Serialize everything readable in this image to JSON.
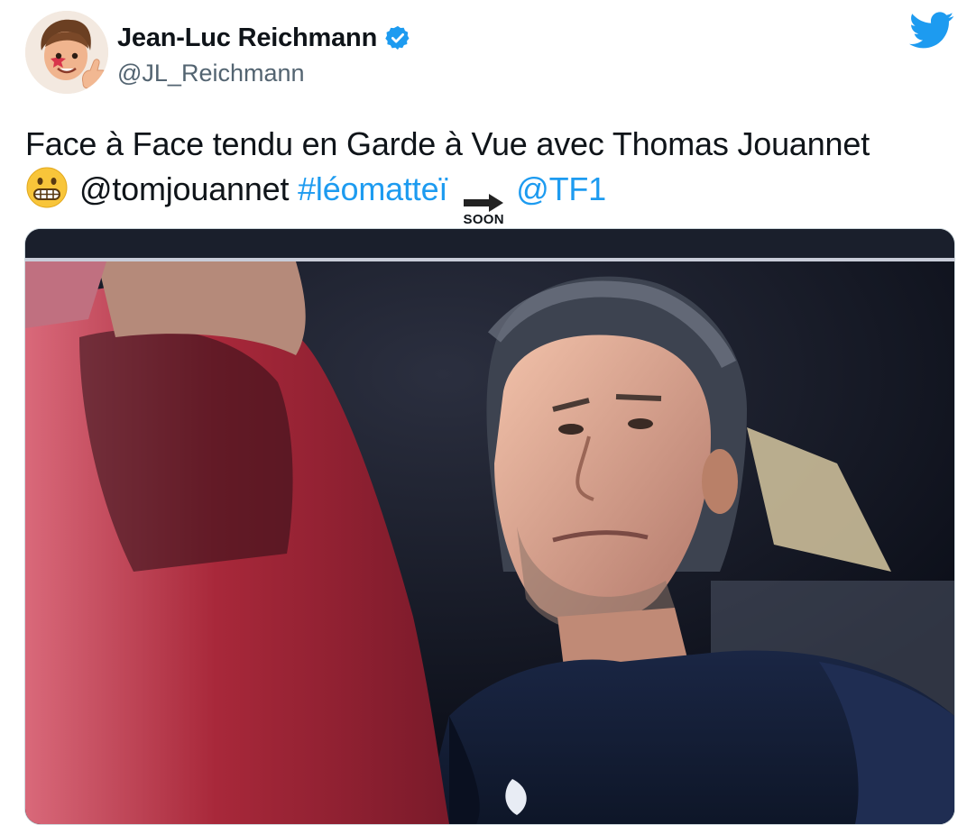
{
  "tweet": {
    "author": {
      "display_name": "Jean-Luc Reichmann",
      "handle": "@JL_Reichmann",
      "verified": true,
      "avatar_icon": "memoji-avatar-icon"
    },
    "brand_icon": "twitter-bird-icon",
    "brand_color": "#1d9bf0",
    "text": {
      "line1": "Face à Face tendu en Garde à Vue avec Thomas Jouannet",
      "emoji_icon": "grimacing-face-emoji-icon",
      "mention_plain": "@tomjouannet",
      "hashtag": "#léomatteï",
      "soon_label": "SOON",
      "soon_icon": "soon-arrow-icon",
      "mention_link": "@TF1"
    },
    "media": {
      "type": "photo",
      "icon": "tv-screenshot-photo"
    }
  }
}
